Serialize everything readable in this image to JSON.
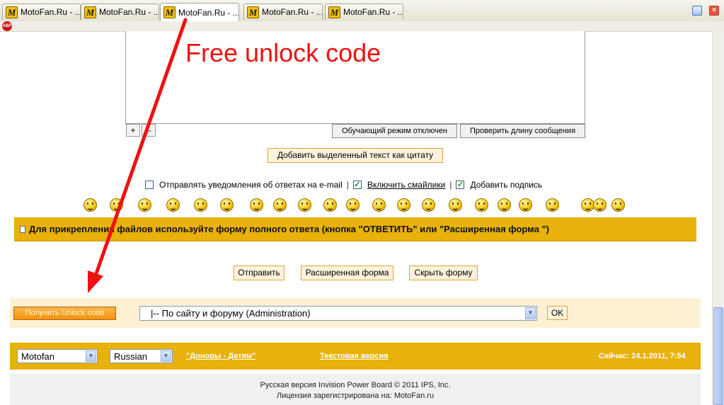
{
  "browser": {
    "tabs": [
      {
        "title": "MotoFan.Ru - ..."
      },
      {
        "title": "MotoFan.Ru - ..."
      },
      {
        "title": "MotoFan.Ru - ..."
      },
      {
        "title": "MotoFan.Ru - ..."
      },
      {
        "title": "MotoFan.Ru - ..."
      }
    ],
    "tab_logo": "M",
    "abp_label": "ABP"
  },
  "editor": {
    "plus_label": "+",
    "minus_label": "–",
    "learning_mode_label": "Обучающий режим отключен",
    "check_length_label": "Проверить длину сообщения",
    "quote_label": "Добавить выделенный текст как цитату"
  },
  "options": {
    "email_notify": {
      "label": "Отправлять уведомления об ответах на e-mail",
      "checked": false
    },
    "enable_smilies": {
      "label": "Включить смайлики",
      "checked": true
    },
    "add_signature": {
      "label": "Добавить подпись",
      "checked": true
    },
    "separator": "|"
  },
  "smilies_count": 22,
  "attach_notice": "Для прикрепления файлов используйте форму полного ответа (кнопка \"ОТВЕТИТЬ\" или \"Расширенная форма \")",
  "actions": {
    "send": "Отправить",
    "advanced": "Расширенная форма",
    "hide": "Скрыть форму"
  },
  "unlock": {
    "button_label": "Получить Unlock code",
    "forum_select": "|-- По сайту и форуму (Administration)",
    "ok_label": "OK"
  },
  "footer": {
    "skin_select": "Motofan",
    "lang_select": "Russian",
    "donors_link": "\"Доноры - Детям\"",
    "text_version_link": "Текстовая версия",
    "now_label": "Сейчас: 24.1.2011, 7:54",
    "copyright_line1": "Русская версия Invision Power Board © 2011  IPS, Inc.",
    "copyright_line2": "Лицензия зарегистрирована на: MotoFan.ru"
  },
  "annotation": {
    "text": "Free unlock code",
    "color": "#ee1111"
  },
  "colors": {
    "accent_yellow": "#e8b10b",
    "button_orange": "#f29412",
    "light_bg": "#fdf0d3"
  }
}
